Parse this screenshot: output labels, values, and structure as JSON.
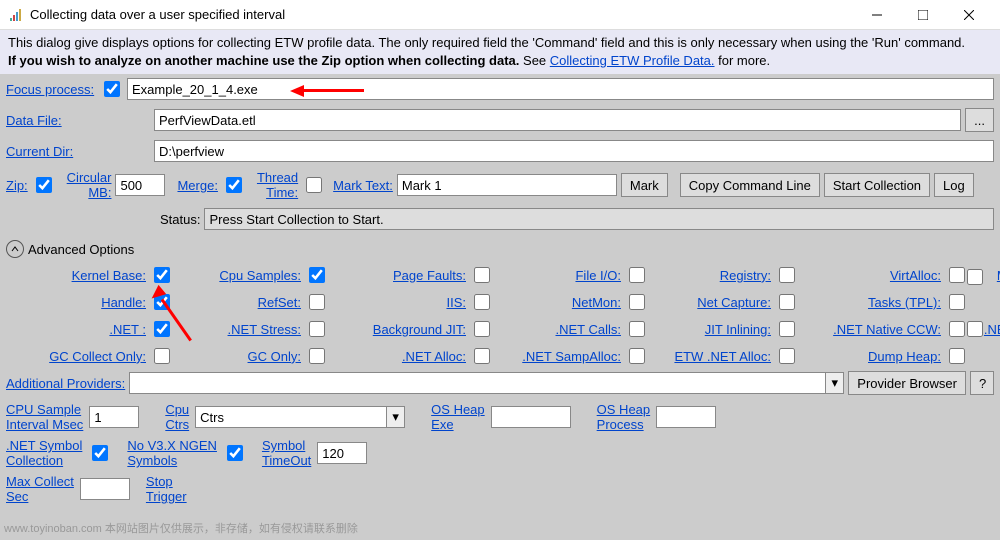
{
  "window": {
    "title": "Collecting data over a user specified interval"
  },
  "intro": {
    "line1": "This dialog give displays options for collecting ETW profile data. The only required field the 'Command' field and this is only necessary when using the 'Run' command.",
    "line2_bold": "If you wish to analyze on another machine use the Zip option when collecting data.",
    "see": " See ",
    "link": "Collecting ETW Profile Data.",
    "more": " for more."
  },
  "fields": {
    "focus_process_lbl": "Focus process:",
    "focus_process_val": "Example_20_1_4.exe",
    "data_file_lbl": "Data File:",
    "data_file_val": "PerfViewData.etl",
    "browse_btn": "...",
    "current_dir_lbl": "Current Dir:",
    "current_dir_val": "D:\\perfview",
    "zip_lbl": "Zip:",
    "circular_mb_lbl": "Circular\nMB:",
    "circular_mb_val": "500",
    "merge_lbl": "Merge:",
    "thread_time_lbl": "Thread\nTime:",
    "mark_text_lbl": "Mark Text:",
    "mark_text_val": "Mark 1",
    "mark_btn": "Mark",
    "copy_cmd_btn": "Copy Command Line",
    "start_btn": "Start Collection",
    "log_btn": "Log",
    "status_lbl": "Status:",
    "status_val": "Press Start Collection to Start."
  },
  "advanced": {
    "header": "Advanced Options",
    "opts": {
      "kernel_base": "Kernel Base:",
      "cpu_samples": "Cpu Samples:",
      "page_faults": "Page Faults:",
      "file_io": "File I/O:",
      "registry": "Registry:",
      "virtalloc": "VirtAlloc:",
      "meminfo": "MemInfo:",
      "handle": "Handle:",
      "refset": "RefSet:",
      "iis": "IIS:",
      "netmon": "NetMon:",
      "net_capture": "Net Capture:",
      "tasks_tpl": "Tasks (TPL):",
      "net": ".NET :",
      "net_stress": ".NET Stress:",
      "background_jit": "Background JIT:",
      "net_calls": ".NET Calls:",
      "jit_inlining": "JIT Inlining:",
      "net_native_ccw": ".NET Native CCW:",
      "net_loader": ".NET Loader:",
      "gc_collect_only": "GC Collect Only:",
      "gc_only": "GC Only:",
      "net_alloc": ".NET Alloc:",
      "net_sampalloc": ".NET SampAlloc:",
      "etw_net_alloc": "ETW .NET Alloc:",
      "dump_heap": "Dump Heap:"
    },
    "additional_providers_lbl": "Additional Providers:",
    "provider_browser_btn": "Provider Browser",
    "help_btn": "?",
    "cpu_sample_interval_lbl": "CPU Sample\nInterval Msec",
    "cpu_sample_interval_val": "1",
    "cpu_ctrs_lbl": "Cpu\nCtrs",
    "cpu_ctrs_val": "Ctrs",
    "os_heap_exe_lbl": "OS Heap\nExe",
    "os_heap_process_lbl": "OS Heap\nProcess",
    "net_symbol_collection_lbl": ".NET Symbol\nCollection",
    "no_v3x_ngen_lbl": "No V3.X NGEN\nSymbols",
    "symbol_timeout_lbl": "Symbol\nTimeOut",
    "symbol_timeout_val": "120",
    "max_collect_sec_lbl": "Max Collect\nSec",
    "stop_trigger_lbl": "Stop\nTrigger"
  },
  "watermark": "www.toyinoban.com 本网站图片仅供展示，非存储，如有侵权请联系删除"
}
